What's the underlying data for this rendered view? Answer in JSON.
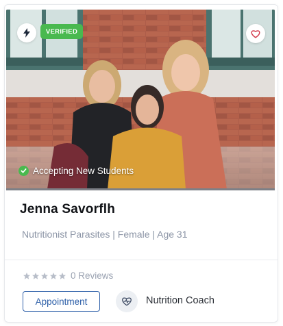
{
  "profile": {
    "verified_label": "VERIFIED",
    "accepting_label": "Accepting New Students",
    "name": "Jenna Savorflh",
    "meta": "Nutritionist Parasites | Female | Age 31",
    "rating": 0,
    "reviews_label": "0 Reviews",
    "appointment_label": "Appointment",
    "coach_label": "Nutrition Coach"
  },
  "colors": {
    "verified_green": "#49b94f",
    "accent_blue": "#2d5fa8",
    "heart_red": "#d23b4c",
    "star_gray": "#b8bec9"
  },
  "icons": {
    "flash": "lightning-icon",
    "favorite": "heart-icon",
    "accepting": "check-circle-icon",
    "star": "star-icon",
    "coach": "heart-pulse-icon"
  }
}
